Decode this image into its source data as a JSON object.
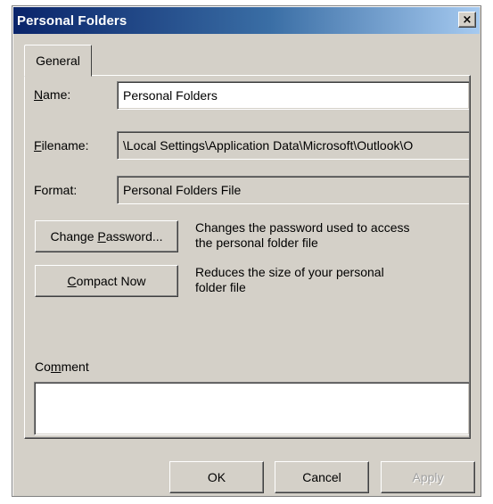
{
  "window": {
    "title": "Personal Folders",
    "close_glyph": "×"
  },
  "tabs": [
    {
      "label": "General",
      "selected": true
    }
  ],
  "fields": {
    "name": {
      "label": "Name:",
      "value": "Personal Folders"
    },
    "filename": {
      "label": "Filename:",
      "value": "\\Local Settings\\Application Data\\Microsoft\\Outlook\\O"
    },
    "format": {
      "label": "Format:",
      "value": "Personal Folders File"
    }
  },
  "actions": {
    "change_password": {
      "label": "Change Password...",
      "description_line1": "Changes the password used to access",
      "description_line2": "the personal folder file"
    },
    "compact_now": {
      "label": "Compact Now",
      "description_line1": "Reduces the size of your personal",
      "description_line2": "folder file"
    }
  },
  "comment": {
    "label": "Comment",
    "value": ""
  },
  "footer": {
    "ok_label": "OK",
    "cancel_label": "Cancel",
    "apply_label": "Apply"
  },
  "colors": {
    "dialog_face": "#d4d0c8",
    "title_gradient_start": "#0a246a",
    "title_gradient_end": "#a6caf0",
    "disabled_text": "#a0a0a0"
  },
  "icons": {
    "close": "close-icon"
  }
}
